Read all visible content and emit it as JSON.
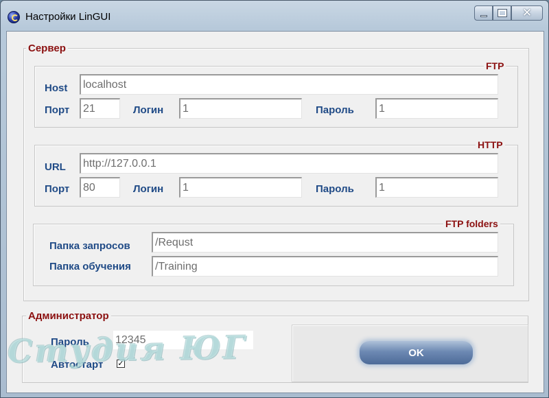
{
  "window": {
    "title": "Настройки LinGUI",
    "icon": "globe-app-icon",
    "caption_buttons": {
      "minimize": "minimize-icon",
      "maximize": "maximize-icon",
      "close": "✕"
    }
  },
  "server": {
    "title": "Сервер",
    "ftp": {
      "title": "FTP",
      "host_label": "Host",
      "host_value": "localhost",
      "port_label": "Порт",
      "port_value": "21",
      "login_label": "Логин",
      "login_value": "1",
      "password_label": "Пароль",
      "password_value": "1"
    },
    "http": {
      "title": "HTTP",
      "url_label": "URL",
      "url_value": "http://127.0.0.1",
      "port_label": "Порт",
      "port_value": "80",
      "login_label": "Логин",
      "login_value": "1",
      "password_label": "Пароль",
      "password_value": "1"
    },
    "folders": {
      "title": "FTP folders",
      "requests_label": "Папка запросов",
      "requests_value": "/Requst",
      "training_label": "Папка обучения",
      "training_value": "/Training"
    }
  },
  "admin": {
    "title": "Администратор",
    "password_label": "Пароль",
    "password_value": "12345",
    "autostart_label": "Автостарт",
    "autostart_checked": true,
    "checkmark": "✓"
  },
  "ok_button": "OK",
  "watermark": "Студия ЮГ",
  "colors": {
    "group_title": "#8b1010",
    "label": "#1f4a86",
    "field_text": "#6d6d6d"
  }
}
